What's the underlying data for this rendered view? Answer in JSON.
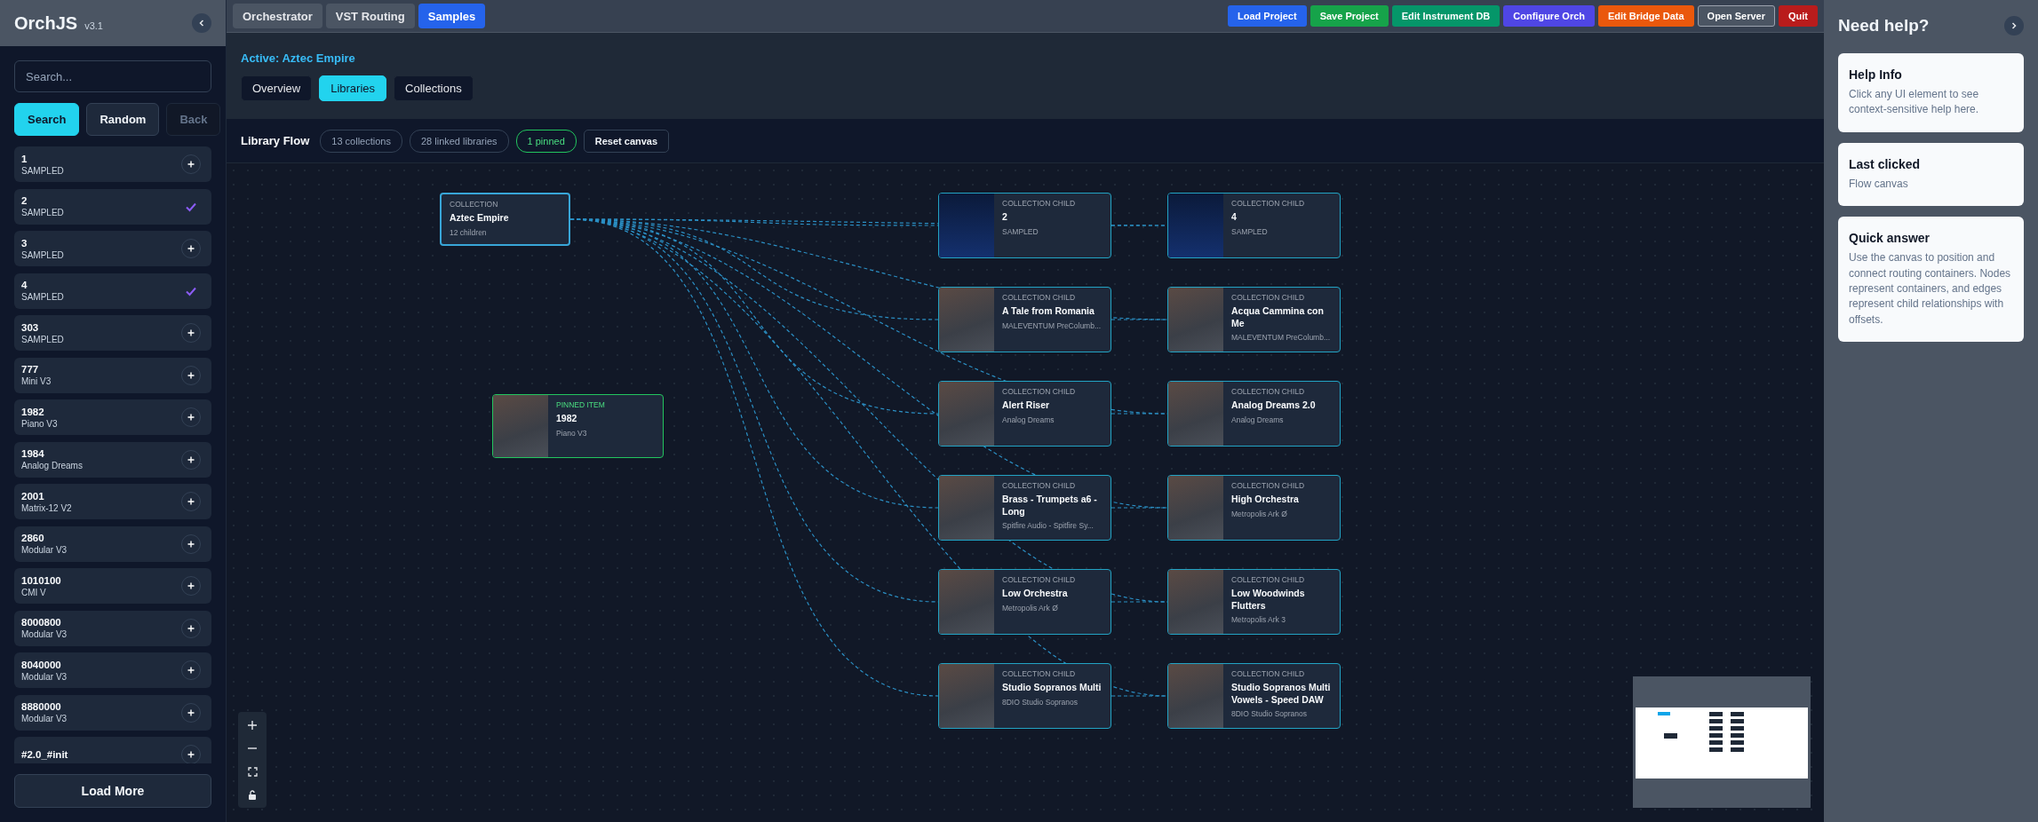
{
  "sidebar": {
    "title": "OrchJS",
    "version": "v3.1",
    "search": {
      "placeholder": "Search..."
    },
    "buttons": [
      {
        "label": "Search",
        "kind": "primary"
      },
      {
        "label": "Random",
        "kind": "secondary"
      },
      {
        "label": "Back",
        "kind": "disabled"
      }
    ],
    "items": [
      {
        "name": "1",
        "sub": "SAMPLED",
        "added": false
      },
      {
        "name": "2",
        "sub": "SAMPLED",
        "added": true
      },
      {
        "name": "3",
        "sub": "SAMPLED",
        "added": false
      },
      {
        "name": "4",
        "sub": "SAMPLED",
        "added": true
      },
      {
        "name": "303",
        "sub": "SAMPLED",
        "added": false
      },
      {
        "name": "777",
        "sub": "Mini V3",
        "added": false
      },
      {
        "name": "1982",
        "sub": "Piano V3",
        "added": false
      },
      {
        "name": "1984",
        "sub": "Analog Dreams",
        "added": false
      },
      {
        "name": "2001",
        "sub": "Matrix-12 V2",
        "added": false
      },
      {
        "name": "2860",
        "sub": "Modular V3",
        "added": false
      },
      {
        "name": "1010100",
        "sub": "CMI V",
        "added": false
      },
      {
        "name": "8000800",
        "sub": "Modular V3",
        "added": false
      },
      {
        "name": "8040000",
        "sub": "Modular V3",
        "added": false
      },
      {
        "name": "8880000",
        "sub": "Modular V3",
        "added": false
      },
      {
        "name": "#2.0_#init",
        "added": false
      }
    ],
    "load_more": "Load More"
  },
  "tabs": [
    {
      "label": "Orchestrator",
      "selected": false
    },
    {
      "label": "VST Routing",
      "selected": false
    },
    {
      "label": "Samples",
      "selected": true
    }
  ],
  "actions": [
    {
      "label": "Load Project",
      "color": "#2563eb"
    },
    {
      "label": "Save Project",
      "color": "#16a34a"
    },
    {
      "label": "Edit Instrument DB",
      "color": "#059669"
    },
    {
      "label": "Configure Orch",
      "color": "#4f46e5"
    },
    {
      "label": "Edit Bridge Data",
      "color": "#ea580c"
    },
    {
      "label": "Open Server",
      "color": "#4b5563"
    },
    {
      "label": "Quit",
      "color": "#b91c1c"
    }
  ],
  "active": "Active: Aztec Empire",
  "subtabs": [
    {
      "label": "Overview",
      "selected": false
    },
    {
      "label": "Libraries",
      "selected": true
    },
    {
      "label": "Collections",
      "selected": false
    }
  ],
  "flow": {
    "title": "Library Flow",
    "chips": [
      {
        "label": "13 collections",
        "highlighted": false
      },
      {
        "label": "28 linked libraries",
        "highlighted": false
      },
      {
        "label": "1 pinned",
        "highlighted": true
      }
    ],
    "reset": "Reset canvas",
    "collection": {
      "tag": "COLLECTION",
      "name": "Aztec Empire",
      "sub": "12 children"
    },
    "pinned": {
      "tag": "PINNED ITEM",
      "name": "1982",
      "sub": "Piano V3"
    },
    "children": [
      {
        "tag": "COLLECTION CHILD",
        "name": "2",
        "sub": "SAMPLED"
      },
      {
        "tag": "COLLECTION CHILD",
        "name": "4",
        "sub": "SAMPLED"
      },
      {
        "tag": "COLLECTION CHILD",
        "name": "A Tale from Romania",
        "sub": "MALEVENTUM PreColumb..."
      },
      {
        "tag": "COLLECTION CHILD",
        "name": "Acqua Cammina con Me",
        "sub": "MALEVENTUM PreColumb..."
      },
      {
        "tag": "COLLECTION CHILD",
        "name": "Alert Riser",
        "sub": "Analog Dreams"
      },
      {
        "tag": "COLLECTION CHILD",
        "name": "Analog Dreams 2.0",
        "sub": "Analog Dreams"
      },
      {
        "tag": "COLLECTION CHILD",
        "name": "Brass - Trumpets a6 - Long",
        "sub": "Spitfire Audio - Spitfire Sy..."
      },
      {
        "tag": "COLLECTION CHILD",
        "name": "High Orchestra",
        "sub": "Metropolis Ark Ø"
      },
      {
        "tag": "COLLECTION CHILD",
        "name": "Low Orchestra",
        "sub": "Metropolis Ark Ø"
      },
      {
        "tag": "COLLECTION CHILD",
        "name": "Low Woodwinds Flutters",
        "sub": "Metropolis Ark 3"
      },
      {
        "tag": "COLLECTION CHILD",
        "name": "Studio Sopranos Multi",
        "sub": "8DIO Studio Sopranos"
      },
      {
        "tag": "COLLECTION CHILD",
        "name": "Studio Sopranos Multi Vowels - Speed DAW",
        "sub": "8DIO Studio Sopranos"
      }
    ]
  },
  "help": {
    "title": "Need help?",
    "cards": [
      {
        "title": "Help Info",
        "text": "Click any UI element to see context-sensitive help here."
      },
      {
        "title": "Last clicked",
        "text": "Flow canvas"
      },
      {
        "title": "Quick answer",
        "text": "Use the canvas to position and connect routing containers. Nodes represent containers, and edges represent child relationships with offsets."
      }
    ]
  }
}
